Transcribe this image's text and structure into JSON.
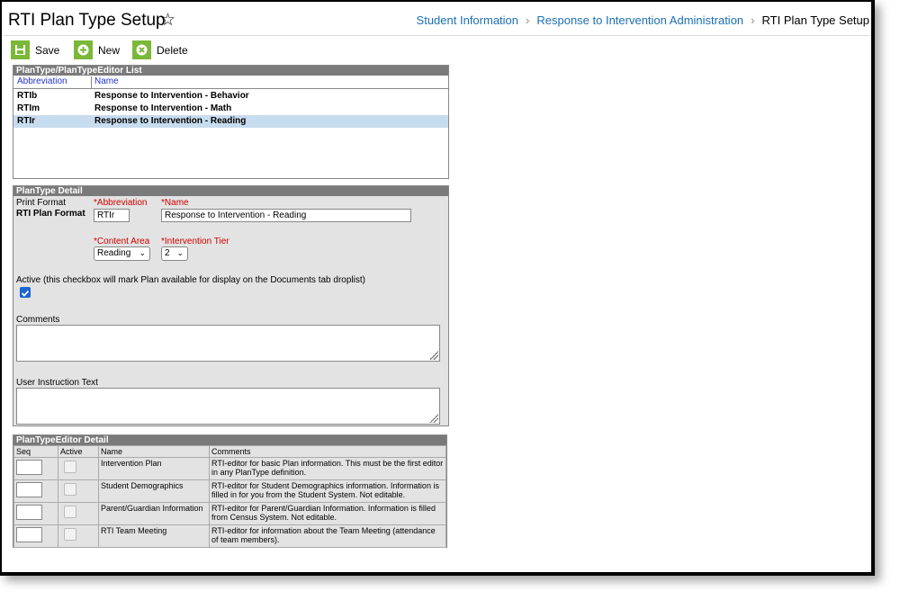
{
  "header": {
    "title": "RTI Plan Type Setup",
    "breadcrumbs": [
      "Student Information",
      "Response to Intervention Administration",
      "RTI Plan Type Setup"
    ]
  },
  "toolbar": {
    "save_label": "Save",
    "new_label": "New",
    "delete_label": "Delete",
    "accent": "#7bb839"
  },
  "list_panel": {
    "title": "PlanType/PlanTypeEditor List",
    "columns": [
      "Abbreviation",
      "Name"
    ],
    "rows": [
      {
        "abbr": "RTIb",
        "name": "Response to Intervention - Behavior"
      },
      {
        "abbr": "RTIm",
        "name": "Response to Intervention - Math"
      },
      {
        "abbr": "RTIr",
        "name": "Response to Intervention - Reading"
      }
    ]
  },
  "detail": {
    "title": "PlanType Detail",
    "print_format_label": "Print Format",
    "print_format_value": "RTI Plan Format",
    "abbr_label": "Abbreviation",
    "abbr_value": "RTIr",
    "name_label": "Name",
    "name_value": "Response to Intervention - Reading",
    "content_area_label": "Content Area",
    "content_area_value": "Reading",
    "tier_label": "Intervention Tier",
    "tier_value": "2",
    "required_mark": "*",
    "active_label": "Active (this checkbox will mark Plan available for display on the Documents tab droplist)",
    "active_checked": true,
    "comments_label": "Comments",
    "instruction_label": "User Instruction Text"
  },
  "editor": {
    "title": "PlanTypeEditor Detail",
    "columns": [
      "Seq",
      "Active",
      "Name",
      "Comments"
    ],
    "rows": [
      {
        "name": "Intervention Plan",
        "comments": "RTI-editor for basic Plan information. This must be the first editor in any PlanType definition."
      },
      {
        "name": "Student Demographics",
        "comments": "RTI-editor for Student Demographics information. Information is filled in for you from the Student System. Not editable."
      },
      {
        "name": "Parent/Guardian Information",
        "comments": "RTI-editor for Parent/Guardian Information. Information is filled from Census System. Not editable."
      },
      {
        "name": "RTI Team Meeting",
        "comments": "RTI-editor for information about the Team Meeting (attendance of team members)."
      }
    ]
  }
}
